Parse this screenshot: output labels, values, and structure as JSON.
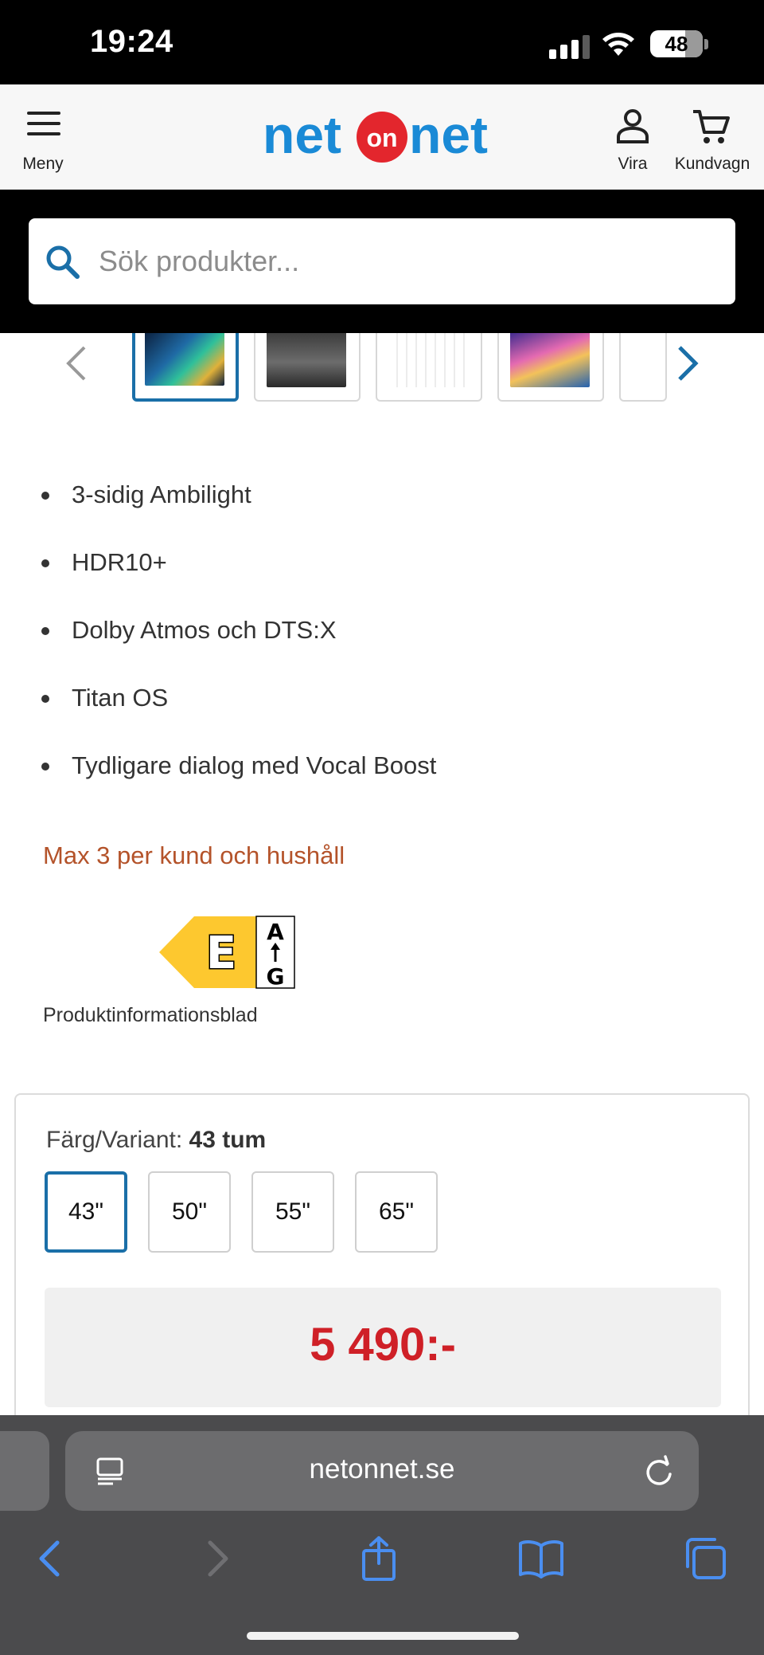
{
  "status_bar": {
    "time": "19:24",
    "battery": "48"
  },
  "header": {
    "menu_label": "Meny",
    "logo": {
      "left": "net",
      "middle": "on",
      "right": "net"
    },
    "account_label": "Vira",
    "cart_label": "Kundvagn",
    "brand_color": "#1a8ad6",
    "logo_circle_color": "#e3262d"
  },
  "search": {
    "placeholder": "Sök produkter..."
  },
  "gallery": {
    "thumbnail_count": 5,
    "active_index": 0
  },
  "features": [
    "3-sidig Ambilight",
    "HDR10+",
    "Dolby Atmos och DTS:X",
    "Titan OS",
    "Tydligare dialog med Vocal Boost"
  ],
  "purchase_limit": "Max 3 per kund och hushåll",
  "energy": {
    "class": "E",
    "scale_top": "A",
    "scale_bottom": "G",
    "color": "#fdc82f",
    "product_info_link": "Produktinformationsblad"
  },
  "variant": {
    "label": "Färg/Variant:",
    "selected": "43 tum",
    "sizes": [
      "43\"",
      "50\"",
      "55\"",
      "65\""
    ],
    "active_index": 0
  },
  "price": {
    "value": "5 490:-",
    "color": "#cf2027"
  },
  "browser": {
    "url": "netonnet.se"
  }
}
